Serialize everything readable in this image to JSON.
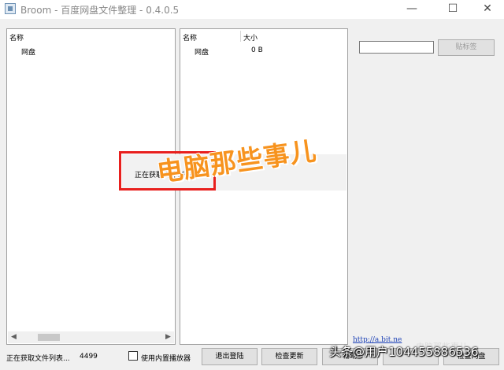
{
  "window": {
    "title": "Broom - 百度网盘文件整理 - 0.4.0.5",
    "minimize_glyph": "—",
    "maximize_glyph": "☐",
    "close_glyph": "✕"
  },
  "left_list": {
    "header": "名称",
    "rows": [
      {
        "name": "网盘"
      }
    ],
    "scroll_left": "◀",
    "scroll_right": "▶"
  },
  "right_list": {
    "headers": [
      "名称",
      "大小"
    ],
    "rows": [
      {
        "name": "网盘",
        "size": "0 B"
      }
    ]
  },
  "tag_input": {
    "value": ""
  },
  "paste_button_label": "贴标签",
  "progress_popup": {
    "text": "正在获取文件列表..."
  },
  "link_text": "http://a.bit.ne",
  "status": {
    "text": "正在获取文件列表...",
    "count": "4499"
  },
  "builtin_player": {
    "label": "使用内置播放器",
    "checked": false
  },
  "buttons": {
    "logout": "退出登陆",
    "check_update": "检查更新",
    "third": "帮助",
    "fourth": "",
    "fifth": "检查网盘"
  },
  "watermarks": {
    "main": "电脑那些事儿",
    "user": "头条@用户104455886536",
    "corner": "电脑那些事儿"
  },
  "colors": {
    "highlight": "#e8201e",
    "watermark": "#f7931e",
    "link": "#1a3fb5"
  }
}
